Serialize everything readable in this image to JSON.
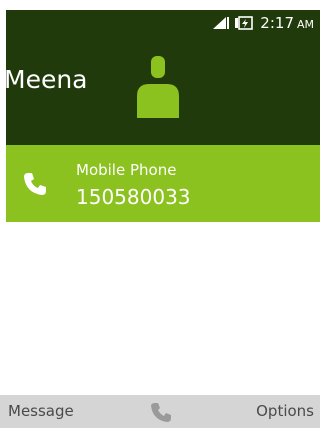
{
  "status_bar": {
    "time": "2:17",
    "ampm": "AM",
    "signal_icon": "signal-icon",
    "battery_icon": "battery-charging-icon"
  },
  "contact": {
    "name": "Meena",
    "avatar_icon": "person-icon"
  },
  "phone": {
    "type": "Mobile Phone",
    "number": "150580033",
    "icon": "phone-icon"
  },
  "softkeys": {
    "left": "Message",
    "center_icon": "call-icon",
    "right": "Options"
  },
  "colors": {
    "header_bg": "#213a0b",
    "accent": "#8bc21f",
    "softkey_bg": "#d5d5d5",
    "softkey_text": "#4a4a4a"
  }
}
